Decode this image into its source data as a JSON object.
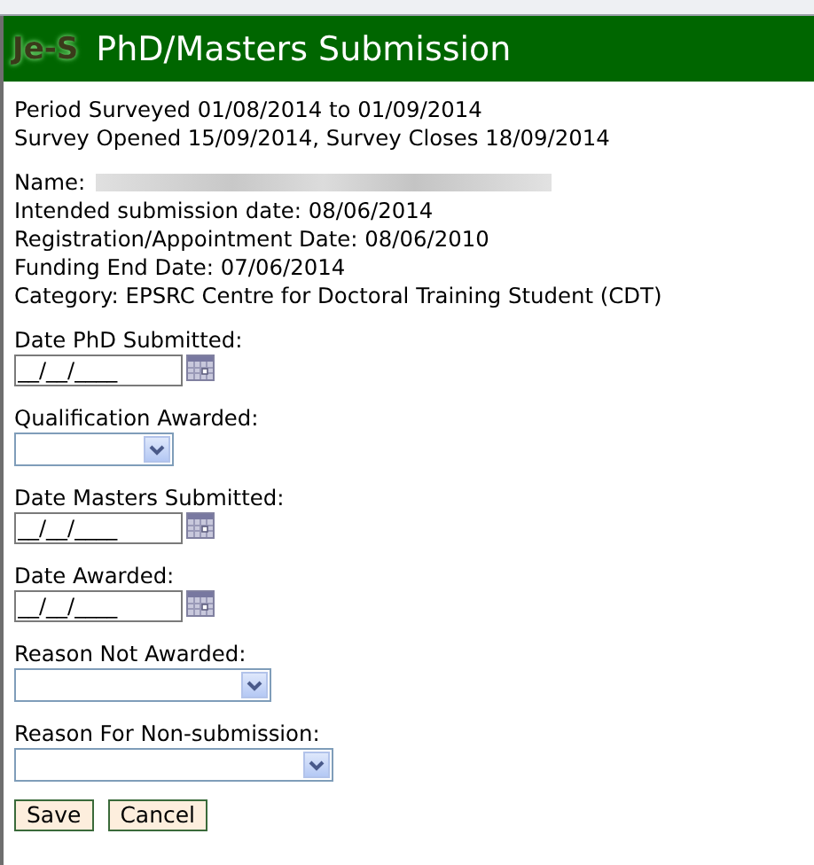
{
  "header": {
    "logo": "Je-S",
    "title": "PhD/Masters Submission"
  },
  "survey": [
    "Period Surveyed 01/08/2014 to 01/09/2014",
    "Survey Opened 15/09/2014, Survey Closes 18/09/2014"
  ],
  "details": {
    "name_label": "Name:",
    "lines": [
      "Intended submission date: 08/06/2014",
      "Registration/Appointment Date: 08/06/2010",
      "Funding End Date: 07/06/2014",
      "Category: EPSRC Centre for Doctoral Training Student (CDT)"
    ]
  },
  "fields": [
    {
      "kind": "date",
      "label": "Date PhD Submitted:",
      "value": "__/__/____"
    },
    {
      "kind": "select",
      "label": "Qualification Awarded:"
    },
    {
      "kind": "date",
      "label": "Date Masters Submitted:",
      "value": "__/__/____"
    },
    {
      "kind": "date",
      "label": "Date Awarded:",
      "value": "__/__/____"
    },
    {
      "kind": "select",
      "label": "Reason Not Awarded:"
    },
    {
      "kind": "select",
      "label": "Reason For Non-submission:"
    }
  ],
  "buttons": [
    "Save",
    "Cancel"
  ]
}
